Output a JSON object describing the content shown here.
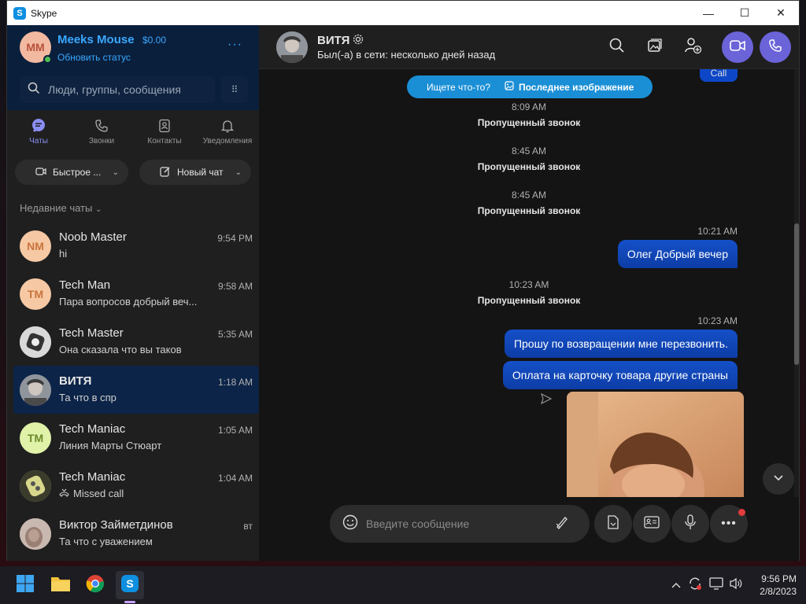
{
  "window": {
    "title": "Skype",
    "app_letter": "S"
  },
  "profile": {
    "initials": "MM",
    "name": "Meeks Mouse",
    "balance": "$0.00",
    "status_link": "Обновить статус",
    "more": "···"
  },
  "search": {
    "placeholder": "Люди, группы, сообщения"
  },
  "nav": [
    {
      "label": "Чаты",
      "icon": "chat-icon"
    },
    {
      "label": "Звонки",
      "icon": "phone-icon"
    },
    {
      "label": "Контакты",
      "icon": "contacts-icon"
    },
    {
      "label": "Уведомления",
      "icon": "bell-icon"
    }
  ],
  "pills": {
    "quick": "Быстрое ...",
    "new_chat": "Новый чат"
  },
  "recent_label": "Недавние чаты",
  "chats": [
    {
      "name": "Noob Master",
      "time": "9:54 PM",
      "preview": "hi",
      "initials": "NM",
      "avatar_color": "#f6c9a4",
      "initials_color": "#c9743d"
    },
    {
      "name": "Tech Man",
      "time": "9:58 AM",
      "preview": "Пара вопросов добрый веч...",
      "initials": "TM",
      "avatar_color": "#f6c9a4",
      "initials_color": "#c9743d"
    },
    {
      "name": "Tech Master",
      "time": "5:35 AM",
      "preview": "Она сказала что вы таков",
      "initials": "",
      "avatar_color": "#d9d9d9",
      "initials_color": "#333333"
    },
    {
      "name": "ВИТЯ",
      "time": "1:18 AM",
      "preview": "Та что в спр",
      "initials": "",
      "avatar_color": "#8a8f95",
      "initials_color": "#333333"
    },
    {
      "name": "Tech Maniac",
      "time": "1:05 AM",
      "preview": "Линия Марты Стюарт",
      "initials": "TM",
      "avatar_color": "#dff2a8",
      "initials_color": "#6b8a2b"
    },
    {
      "name": "Tech Maniac",
      "time": "1:04 AM",
      "preview": "Missed call",
      "initials": "",
      "avatar_color": "#cfcf9a",
      "initials_color": "#333333"
    },
    {
      "name": "Виктор Займетдинов",
      "time": "вт",
      "preview": "Та что с уважением",
      "initials": "",
      "avatar_color": "#c9b8b0",
      "initials_color": "#333333"
    }
  ],
  "conversation": {
    "name": "ВИТЯ",
    "presence": "Был(-а) в сети: несколько дней назад",
    "banner_question": "Ищете что-то?",
    "banner_last": "Последнее изображение",
    "top_bubble": "Call",
    "missed": [
      {
        "time": "8:09 AM",
        "text": "Пропущенный звонок"
      },
      {
        "time": "8:45 AM",
        "text": "Пропущенный звонок"
      },
      {
        "time": "8:45 AM",
        "text": "Пропущенный звонок"
      },
      {
        "time": "10:23 AM",
        "text": "Пропущенный звонок"
      }
    ],
    "outgoing": [
      {
        "time": "10:21 AM",
        "text": "Олег Добрый вечер"
      },
      {
        "time": "10:23 AM",
        "text": "Прошу по возвращении мне перезвонить."
      },
      {
        "time": "",
        "text": "Оплата на карточку товара другие страны"
      }
    ]
  },
  "composer": {
    "placeholder": "Введите сообщение"
  },
  "taskbar": {
    "time": "9:56 PM",
    "date": "2/8/2023"
  },
  "colors": {
    "accent": "#3aa8ff",
    "call_button": "#6b63d8",
    "bubble": "#1550c8",
    "banner": "#1b8fd6"
  }
}
